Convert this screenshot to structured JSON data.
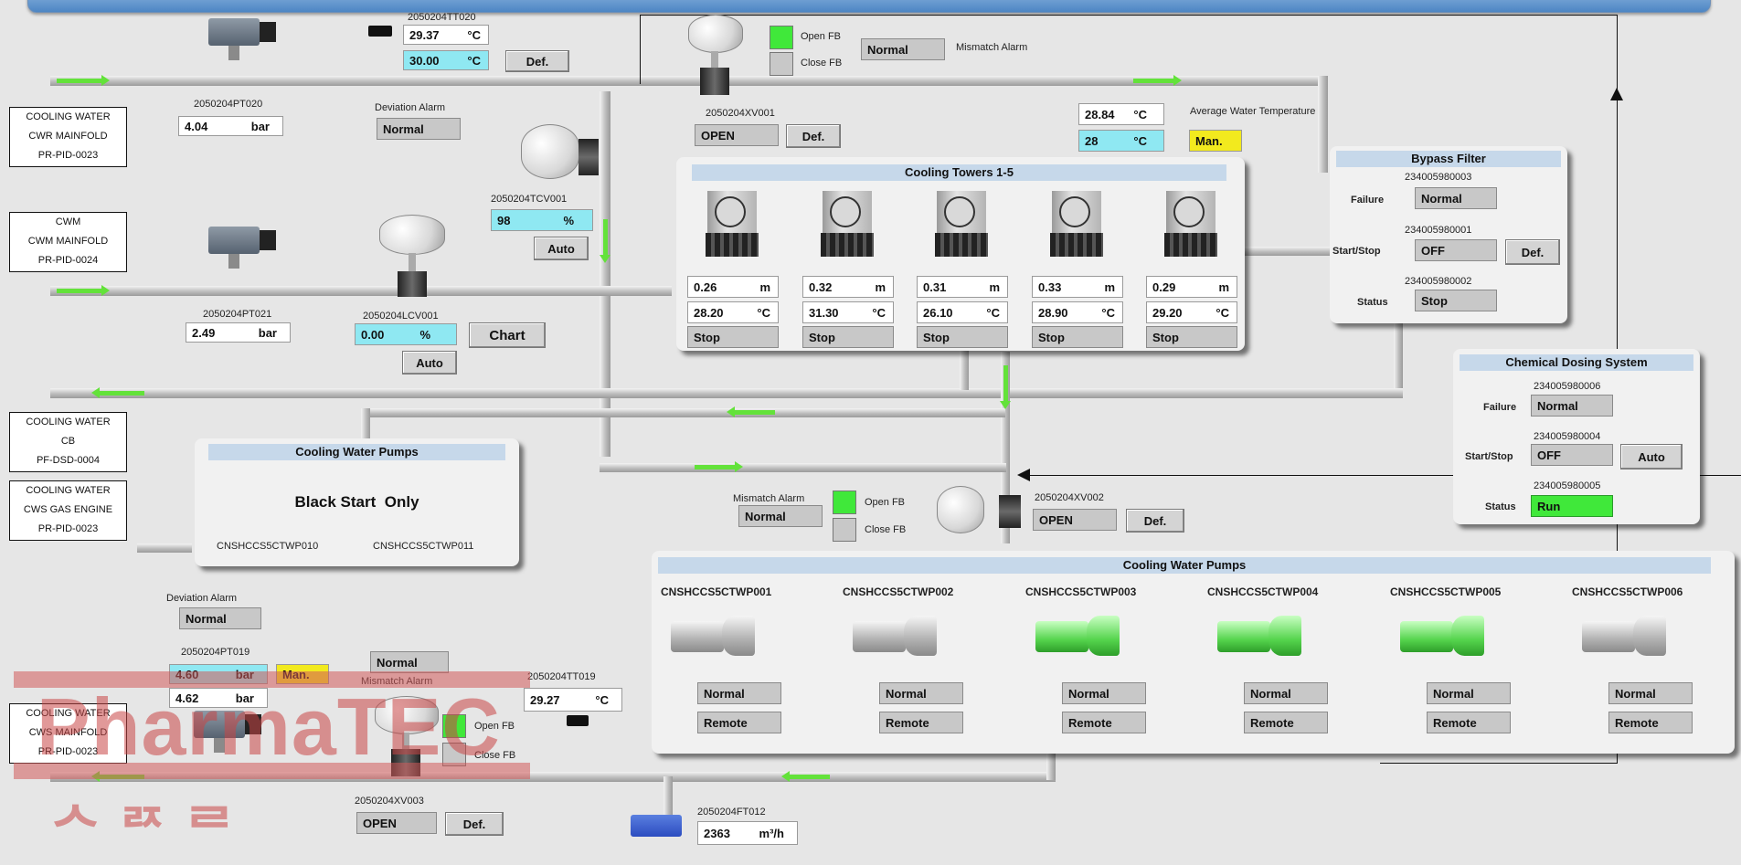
{
  "ct_tt020": {
    "tag": "2050204TT020",
    "pv": "29.37",
    "unit": "°C",
    "sp": "30.00",
    "def": "Def."
  },
  "ct_pt020": {
    "tag": "2050204PT020",
    "value": "4.04",
    "unit": "bar"
  },
  "dev_alarm_top": {
    "label": "Deviation Alarm",
    "value": "Normal"
  },
  "cwr_box": {
    "line1": "COOLING WATER",
    "line2": "CWR MAINFOLD",
    "line3": "PR-PID-0023"
  },
  "cwm_box": {
    "line1": "CWM",
    "line2": "CWM MAINFOLD",
    "line3": "PR-PID-0024"
  },
  "cb_box": {
    "line1": "COOLING WATER",
    "line2": "CB",
    "line3": "PF-DSD-0004"
  },
  "gas_box": {
    "line1": "COOLING WATER",
    "line2": "CWS GAS ENGINE",
    "line3": "PR-PID-0023"
  },
  "cws_box": {
    "line1": "COOLING WATER",
    "line2": "CWS MAINFOLD",
    "line3": "PR-PID-0023"
  },
  "xv001": {
    "open_fb": "Open FB",
    "close_fb": "Close FB",
    "state": "Normal",
    "mismatch": "Mismatch Alarm",
    "tag": "2050204XV001",
    "value": "OPEN",
    "def": "Def."
  },
  "tcv001": {
    "tag": "2050204TCV001",
    "value": "98",
    "unit": "%",
    "mode": "Auto"
  },
  "pt021": {
    "tag": "2050204PT021",
    "value": "2.49",
    "unit": "bar"
  },
  "lcv001": {
    "tag": "2050204LCV001",
    "value": "0.00",
    "unit": "%",
    "mode": "Auto",
    "chart": "Chart"
  },
  "avg_temp": {
    "pv": "28.84",
    "unit": "°C",
    "label": "Average Water Temperature",
    "sp": "28",
    "mode": "Man."
  },
  "towers": {
    "title": "Cooling Towers 1-5",
    "items": [
      {
        "level": "0.26",
        "lunit": "m",
        "temp": "28.20",
        "tunit": "°C",
        "state": "Stop"
      },
      {
        "level": "0.32",
        "lunit": "m",
        "temp": "31.30",
        "tunit": "°C",
        "state": "Stop"
      },
      {
        "level": "0.31",
        "lunit": "m",
        "temp": "26.10",
        "tunit": "°C",
        "state": "Stop"
      },
      {
        "level": "0.33",
        "lunit": "m",
        "temp": "28.90",
        "tunit": "°C",
        "state": "Stop"
      },
      {
        "level": "0.29",
        "lunit": "m",
        "temp": "29.20",
        "tunit": "°C",
        "state": "Stop"
      }
    ]
  },
  "bypass": {
    "title": "Bypass Filter",
    "tag1": "234005980003",
    "failure_label": "Failure",
    "failure": "Normal",
    "tag2": "234005980001",
    "ss_label": "Start/Stop",
    "ss": "OFF",
    "def": "Def.",
    "tag3": "234005980002",
    "status_label": "Status",
    "status": "Stop"
  },
  "chem": {
    "title": "Chemical Dosing System",
    "tag1": "234005980006",
    "failure_label": "Failure",
    "failure": "Normal",
    "tag2": "234005980004",
    "ss_label": "Start/Stop",
    "ss": "OFF",
    "mode": "Auto",
    "tag3": "234005980005",
    "status_label": "Status",
    "status": "Run"
  },
  "pumps_small": {
    "title": "Cooling Water Pumps",
    "msg": "Black Start  Only",
    "p1": "CNSHCCS5CTWP010",
    "p2": "CNSHCCS5CTWP011"
  },
  "xv002": {
    "mismatch": "Mismatch Alarm",
    "state": "Normal",
    "open_fb": "Open FB",
    "close_fb": "Close FB",
    "tag": "2050204XV002",
    "value": "OPEN",
    "def": "Def."
  },
  "pumps": {
    "title": "Cooling Water Pumps",
    "items": [
      {
        "tag": "CNSHCCS5CTWP001",
        "state": "Normal",
        "mode": "Remote",
        "running": false
      },
      {
        "tag": "CNSHCCS5CTWP002",
        "state": "Normal",
        "mode": "Remote",
        "running": false
      },
      {
        "tag": "CNSHCCS5CTWP003",
        "state": "Normal",
        "mode": "Remote",
        "running": true
      },
      {
        "tag": "CNSHCCS5CTWP004",
        "state": "Normal",
        "mode": "Remote",
        "running": true
      },
      {
        "tag": "CNSHCCS5CTWP005",
        "state": "Normal",
        "mode": "Remote",
        "running": true
      },
      {
        "tag": "CNSHCCS5CTWP006",
        "state": "Normal",
        "mode": "Remote",
        "running": false
      }
    ]
  },
  "dev_alarm_bot": {
    "label": "Deviation Alarm",
    "value": "Normal"
  },
  "pt019": {
    "tag": "2050204PT019",
    "pv": "4.60",
    "unit": "bar",
    "mode": "Man.",
    "value2": "4.62"
  },
  "xv003": {
    "state": "Normal",
    "mismatch": "Mismatch Alarm",
    "open_fb": "Open FB",
    "close_fb": "Close FB",
    "tag": "2050204XV003",
    "value": "OPEN",
    "def": "Def."
  },
  "tt019": {
    "tag": "2050204TT019",
    "value": "29.27",
    "unit": "°C"
  },
  "ft012": {
    "tag": "2050204FT012",
    "value": "2363",
    "unit": "m³/h"
  },
  "watermark": {
    "word": "PharmaTEC",
    "sub": "ᄉᄅᄌᄅ"
  },
  "colors": {
    "cyan": "#8fe8f2",
    "yellow": "#f2ea1e",
    "green": "#40e83a",
    "flow": "#63e23a",
    "panel_title": "#c6d8ea"
  }
}
